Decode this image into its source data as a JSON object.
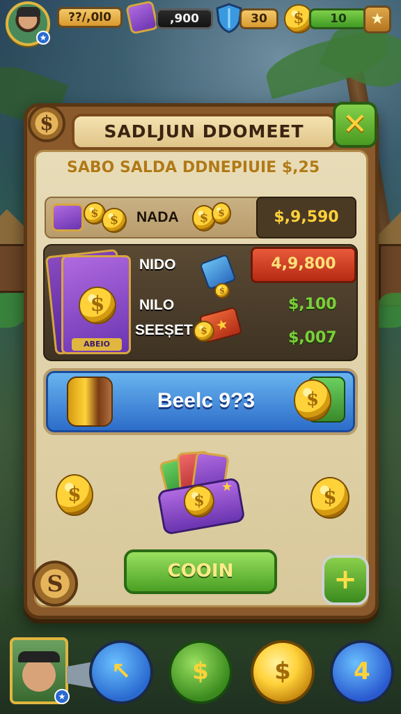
{
  "topbar": {
    "stat1": "??/,0l0",
    "stat2": ",900",
    "stat3": "30",
    "stat4": "10",
    "star_icon": "star-icon",
    "shield_icon": "shield-icon",
    "coin_icon": "coin-icon",
    "card_icon": "card-icon"
  },
  "dialog": {
    "title": "SADLJUN DDOMEET",
    "corner_top_symbol": "$",
    "corner_bottom_symbol": "S",
    "close_symbol": "✕",
    "subtitle": "SABO SALDA DDNEPIUIE $,25",
    "row1": {
      "label": "NADA",
      "price": "$,9,590"
    },
    "item_group": {
      "label1": "NIDO",
      "label2": "NILO",
      "label3": "SEEȘET",
      "card_label": "ABEIO",
      "price_red": "4,9,800",
      "price_green1": "$,100",
      "price_green2": "$,007"
    },
    "blue_bar_text": "Beelc 9?3",
    "coin_button": "COOIN",
    "plus_symbol": "+"
  },
  "bottom_nav": {
    "btn1_symbol": "↖",
    "btn2_symbol": "$",
    "btn3_symbol": "$",
    "btn4_symbol": "4",
    "avatar_badge": "★"
  },
  "colors": {
    "gold": "#ffd23a",
    "panel_brown": "#8a5a2c",
    "parchment": "#e8dcb8",
    "green_button": "#4aa024",
    "blue_bar": "#2a6ac8",
    "red_price": "#b62a14"
  }
}
